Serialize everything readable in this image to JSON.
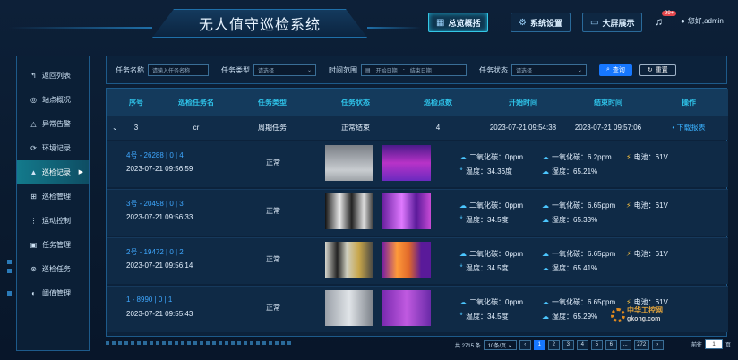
{
  "header": {
    "title": "无人值守巡检系统",
    "buttons": [
      {
        "label": "总览概括",
        "icon": "grid-icon"
      },
      {
        "label": "系统设置",
        "icon": "gear-icon"
      },
      {
        "label": "大屏展示",
        "icon": "monitor-icon"
      }
    ],
    "notify_count": "99+",
    "user": "您好,admin"
  },
  "sidebar": {
    "items": [
      {
        "label": "返回列表",
        "icon": "back-icon"
      },
      {
        "label": "站点概况",
        "icon": "location-icon"
      },
      {
        "label": "异常告警",
        "icon": "warning-icon"
      },
      {
        "label": "环境记录",
        "icon": "environment-icon"
      },
      {
        "label": "巡检记录",
        "icon": "inspection-record-icon",
        "active": true
      },
      {
        "label": "巡检管理",
        "icon": "manage-icon"
      },
      {
        "label": "运动控制",
        "icon": "control-icon"
      },
      {
        "label": "任务管理",
        "icon": "task-icon"
      },
      {
        "label": "巡检任务",
        "icon": "patrol-task-icon"
      },
      {
        "label": "阈值管理",
        "icon": "threshold-icon"
      }
    ]
  },
  "filter": {
    "task_name_label": "任务名称",
    "task_name_placeholder": "请输入任务名称",
    "task_type_label": "任务类型",
    "task_type_value": "请选择",
    "time_range_label": "时间范围",
    "start_placeholder": "开始日期",
    "range_sep": "-",
    "end_placeholder": "结束日期",
    "task_status_label": "任务状态",
    "task_status_value": "请选择",
    "query_label": "查询",
    "reset_label": "重置"
  },
  "table": {
    "headers": [
      "序号",
      "巡检任务名",
      "任务类型",
      "任务状态",
      "巡检点数",
      "开始时间",
      "结束时间",
      "操作"
    ],
    "group": {
      "index": "3",
      "name": "cr",
      "type": "周期任务",
      "status": "正常结束",
      "points": "4",
      "start": "2023-07-21 09:54:38",
      "end": "2023-07-21 09:57:06",
      "action": "• 下载报表"
    },
    "records": [
      {
        "name": "4号 - 26288 | 0 | 4",
        "time": "2023-07-21 09:56:59",
        "status": "正常",
        "co2": "二氧化碳：0ppm",
        "co": "一氧化碳：6.2ppm",
        "power": "电池：61V",
        "temp": "温度：34.36度",
        "humidity": "湿度：65.21%"
      },
      {
        "name": "3号 - 20498 | 0 | 3",
        "time": "2023-07-21 09:56:33",
        "status": "正常",
        "co2": "二氧化碳：0ppm",
        "co": "一氧化碳：6.65ppm",
        "power": "电池：61V",
        "temp": "温度：34.5度",
        "humidity": "湿度：65.33%"
      },
      {
        "name": "2号 - 19472 | 0 | 2",
        "time": "2023-07-21 09:56:14",
        "status": "正常",
        "co2": "二氧化碳：0ppm",
        "co": "一氧化碳：6.65ppm",
        "power": "电池：61V",
        "temp": "温度：34.5度",
        "humidity": "湿度：65.41%"
      },
      {
        "name": "1 - 8990 | 0 | 1",
        "time": "2023-07-21 09:55:43",
        "status": "正常",
        "co2": "二氧化碳：0ppm",
        "co": "一氧化碳：6.65ppm",
        "power": "电池：61V",
        "temp": "温度：34.5度",
        "humidity": "湿度：65.29%"
      }
    ]
  },
  "pagination": {
    "total": "共 2715 条",
    "page_size": "10条/页",
    "pages": [
      "1",
      "2",
      "3",
      "4",
      "5",
      "6",
      "...",
      "272"
    ],
    "current": "1",
    "goto_label": "前往",
    "goto_value": "1",
    "goto_suffix": "页"
  },
  "watermark": {
    "line1": "中华工控网",
    "line2": "gkong.com"
  }
}
